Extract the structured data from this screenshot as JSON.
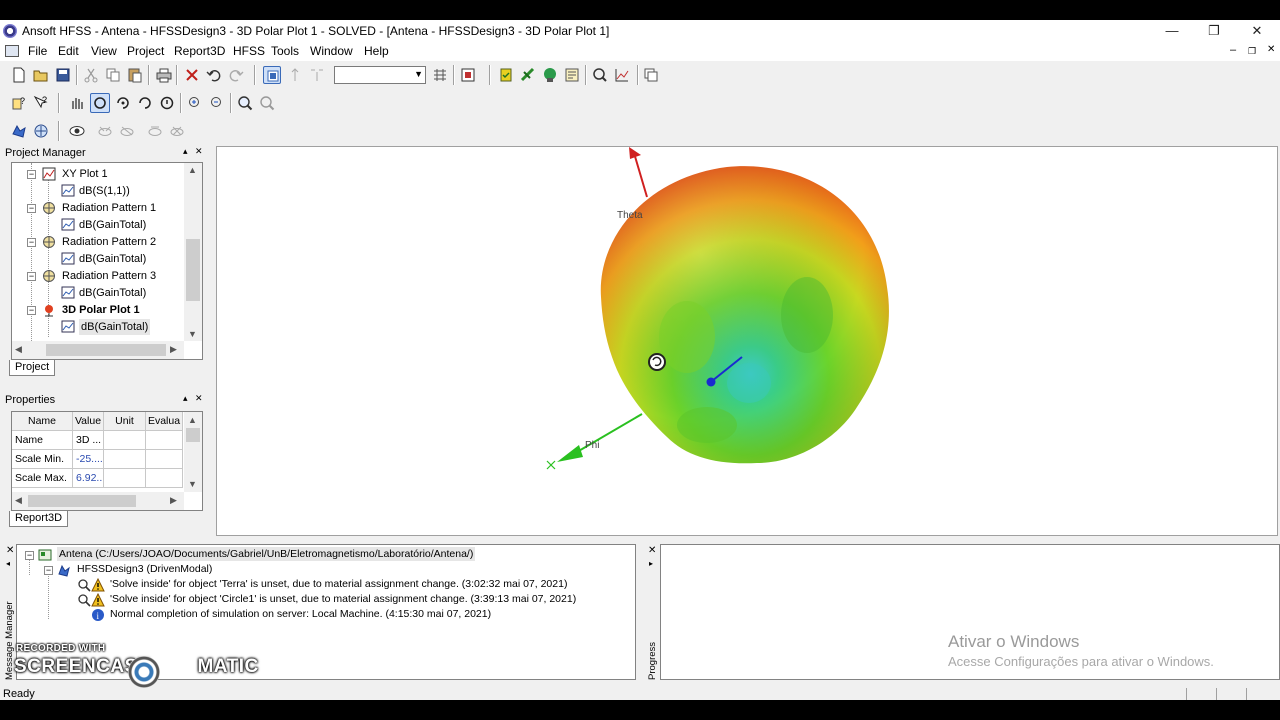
{
  "window": {
    "title": "Ansoft HFSS - Antena - HFSSDesign3 - 3D Polar Plot 1 - SOLVED - [Antena - HFSSDesign3 - 3D Polar Plot 1]",
    "minimize": "—",
    "restore": "❐",
    "close": "✕"
  },
  "menu": {
    "file": "File",
    "edit": "Edit",
    "view": "View",
    "project": "Project",
    "report3d": "Report3D",
    "hfss": "HFSS",
    "tools": "Tools",
    "window": "Window",
    "help": "Help",
    "child_min": "–",
    "child_restore": "❐",
    "child_close": "✕"
  },
  "project_manager": {
    "header": "Project Manager",
    "pin": "▴",
    "close": "✕",
    "tab": "Project",
    "nodes": [
      {
        "label": "XY Plot 1",
        "icon": "xy-plot-icon"
      },
      {
        "label": "dB(S(1,1))",
        "icon": "trace-icon"
      },
      {
        "label": "Radiation Pattern 1",
        "icon": "radiation-pattern-icon"
      },
      {
        "label": "dB(GainTotal)",
        "icon": "trace-icon"
      },
      {
        "label": "Radiation Pattern 2",
        "icon": "radiation-pattern-icon"
      },
      {
        "label": "dB(GainTotal)",
        "icon": "trace-icon"
      },
      {
        "label": "Radiation Pattern 3",
        "icon": "radiation-pattern-icon"
      },
      {
        "label": "dB(GainTotal)",
        "icon": "trace-icon"
      },
      {
        "label": "3D Polar Plot 1",
        "icon": "polar-plot-3d-icon"
      },
      {
        "label": "dB(GainTotal)",
        "icon": "trace-icon"
      }
    ]
  },
  "properties": {
    "header": "Properties",
    "pin": "▴",
    "close": "✕",
    "tab": "Report3D",
    "columns": [
      "Name",
      "Value",
      "Unit",
      "Evalua"
    ],
    "rows": [
      {
        "name": "Name",
        "value": "3D ...",
        "unit": "",
        "eval": ""
      },
      {
        "name": "Scale Min.",
        "value": "-25....",
        "unit": "",
        "eval": ""
      },
      {
        "name": "Scale Max.",
        "value": "6.92...",
        "unit": "",
        "eval": ""
      }
    ]
  },
  "viewport": {
    "axis_theta": "Theta",
    "axis_phi": "Phi",
    "axis_x": "X",
    "colors": {
      "top": "#e3321a",
      "mid": "#f2c01a",
      "low": "#6cd42a",
      "inner": "#2ec8c0"
    }
  },
  "messages": {
    "panel_label": "Message Manager",
    "close": "✕",
    "project": "Antena (C:/Users/JOAO/Documents/Gabriel/UnB/Eletromagnetismo/Laboratório/Antena/)",
    "design": "HFSSDesign3 (DrivenModal)",
    "items": [
      {
        "type": "warning",
        "text": "'Solve inside' for object 'Terra' is unset, due to material assignment change. (3:02:32  mai 07, 2021)"
      },
      {
        "type": "warning",
        "text": "'Solve inside' for object 'Circle1' is unset, due to material assignment change. (3:39:13  mai 07, 2021)"
      },
      {
        "type": "info",
        "text": "Normal completion of simulation on server: Local Machine. (4:15:30  mai 07, 2021)"
      }
    ]
  },
  "progress": {
    "panel_label": "Progress",
    "close": "✕",
    "pin": "▸"
  },
  "status": {
    "text": "Ready"
  },
  "watermark": {
    "line1": "Ativar o Windows",
    "line2": "Acesse Configurações para ativar o Windows."
  },
  "screencast": {
    "recorded": "RECORDED WITH",
    "brand_left": "SCREENCAST",
    "brand_right": "MATIC"
  }
}
